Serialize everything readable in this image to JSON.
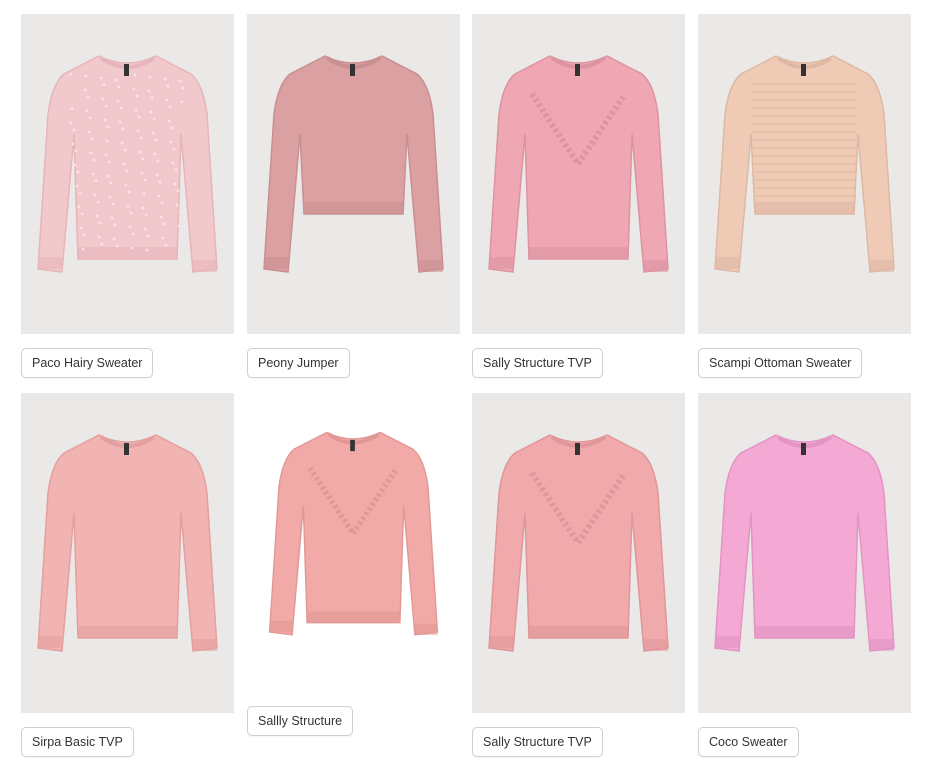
{
  "products": [
    {
      "name": "Paco Hairy Sweater",
      "color": "#f1c9cc",
      "shade": "#e7b4b9",
      "style": "hairy"
    },
    {
      "name": "Peony Jumper",
      "color": "#dba1a2",
      "shade": "#c98f91",
      "style": "jumper"
    },
    {
      "name": "Sally Structure TVP",
      "color": "#eea7b3",
      "shade": "#de93a1",
      "style": "structure"
    },
    {
      "name": "Scampi Ottoman Sweater",
      "color": "#efcbb6",
      "shade": "#ddb8a3",
      "style": "ottoman"
    },
    {
      "name": "Sirpa Basic TVP",
      "color": "#f2b4b3",
      "shade": "#e2a09f",
      "style": "basic"
    },
    {
      "name": "Sallly Structure",
      "color": "#f1aaa8",
      "shade": "#e29794",
      "style": "structure"
    },
    {
      "name": "Sally Structure TVP",
      "color": "#f0aaac",
      "shade": "#e19699",
      "style": "structure"
    },
    {
      "name": "Coco Sweater",
      "color": "#f3a9d3",
      "shade": "#e394c3",
      "style": "basic"
    }
  ]
}
